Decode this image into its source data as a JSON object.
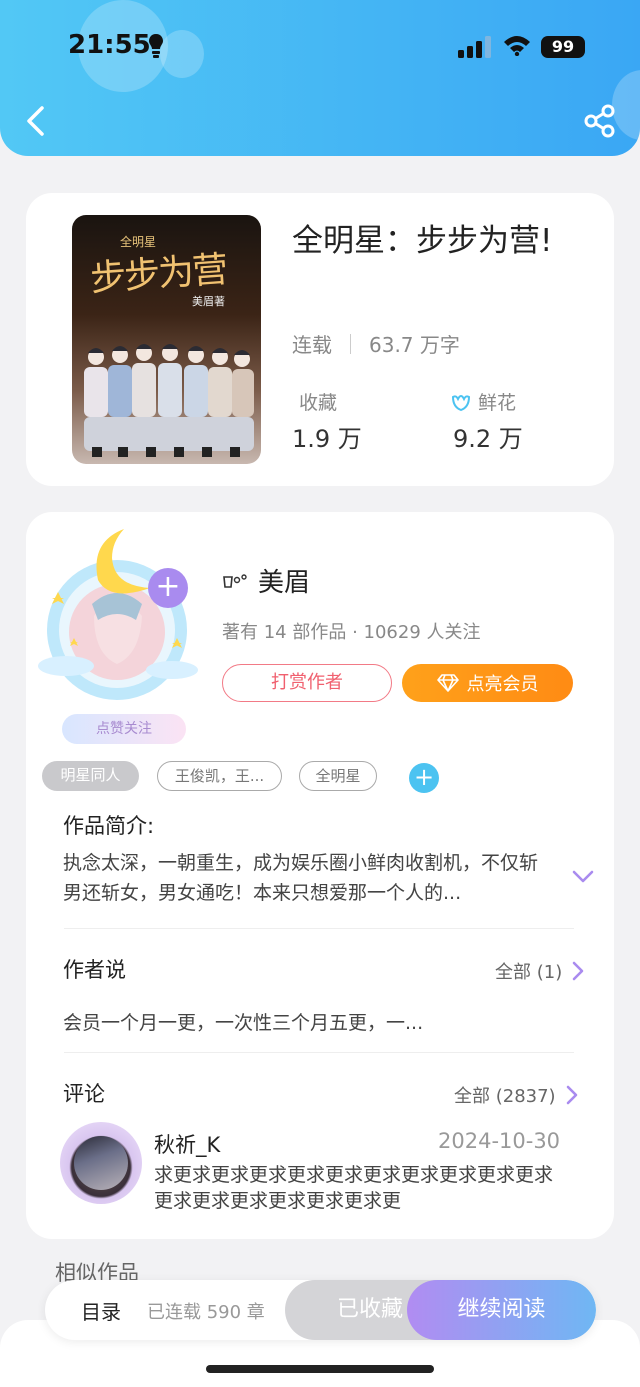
{
  "status_bar": {
    "time": "21:55",
    "battery": "99"
  },
  "book": {
    "title": "全明星：步步为营!",
    "cover_series": "全明星",
    "cover_title": "步步为营",
    "cover_author": "美眉著",
    "status": "连载",
    "word_count": "63.7 万字",
    "favorites_label": "收藏",
    "favorites_value": "1.9 万",
    "flowers_label": "鲜花",
    "flowers_value": "9.2 万"
  },
  "author": {
    "name": "美眉",
    "stats": "著有 14 部作品 · 10629 人关注",
    "like_follow": "点赞关注",
    "tip_button": "打赏作者",
    "vip_button": "点亮会员"
  },
  "tags": [
    "明星同人",
    "王俊凯，王...",
    "全明星"
  ],
  "intro": {
    "title": "作品简介:",
    "text": "执念太深，一朝重生，成为娱乐圈小鲜肉收割机，不仅斩男还斩女，男女通吃！本来只想爱那一个人的..."
  },
  "author_says": {
    "title": "作者说",
    "more": "全部 (1)",
    "text": "会员一个月一更，一次性三个月五更，一..."
  },
  "comments": {
    "title": "评论",
    "more": "全部 (2837)",
    "items": [
      {
        "user": "秋祈_K",
        "date": "2024-10-30",
        "text": "求更求更求更求更求更求更求更求更求更求更求更求更求更求更求更求更求更"
      }
    ]
  },
  "similar_title": "相似作品",
  "bottom_bar": {
    "toc": "目录",
    "chapters": "已连载 590 章",
    "saved": "已收藏",
    "continue": "继续阅读"
  },
  "colors": {
    "header": "#3aa7f4",
    "accent_orange": "#ff8b14",
    "accent_purple": "#a98bef",
    "tip_red": "#f0606f"
  }
}
